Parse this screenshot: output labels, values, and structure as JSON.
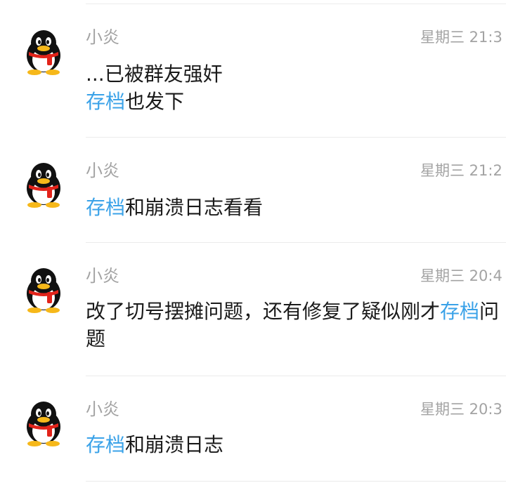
{
  "messages": [
    {
      "sender": "小炎",
      "time": "星期三 21:3",
      "parts": [
        {
          "text": "...已被群友强奸",
          "highlight": false
        },
        {
          "text": "\n",
          "highlight": false
        },
        {
          "text": "存档",
          "highlight": true
        },
        {
          "text": "也发下",
          "highlight": false
        }
      ]
    },
    {
      "sender": "小炎",
      "time": "星期三 21:2",
      "parts": [
        {
          "text": "存档",
          "highlight": true
        },
        {
          "text": "和崩溃日志看看",
          "highlight": false
        }
      ]
    },
    {
      "sender": "小炎",
      "time": "星期三 20:4",
      "parts": [
        {
          "text": "改了切号摆摊问题，还有修复了疑似刚才",
          "highlight": false
        },
        {
          "text": "存档",
          "highlight": true
        },
        {
          "text": "问题",
          "highlight": false
        }
      ]
    },
    {
      "sender": "小炎",
      "time": "星期三 20:3",
      "parts": [
        {
          "text": "存档",
          "highlight": true
        },
        {
          "text": "和崩溃日志",
          "highlight": false
        }
      ]
    }
  ],
  "colors": {
    "highlight": "#3aa2e8",
    "meta": "#a3a3a3",
    "text": "#1a1a1a",
    "divider": "#ebebeb"
  },
  "icons": {
    "avatar": "qq-penguin-avatar-icon"
  }
}
